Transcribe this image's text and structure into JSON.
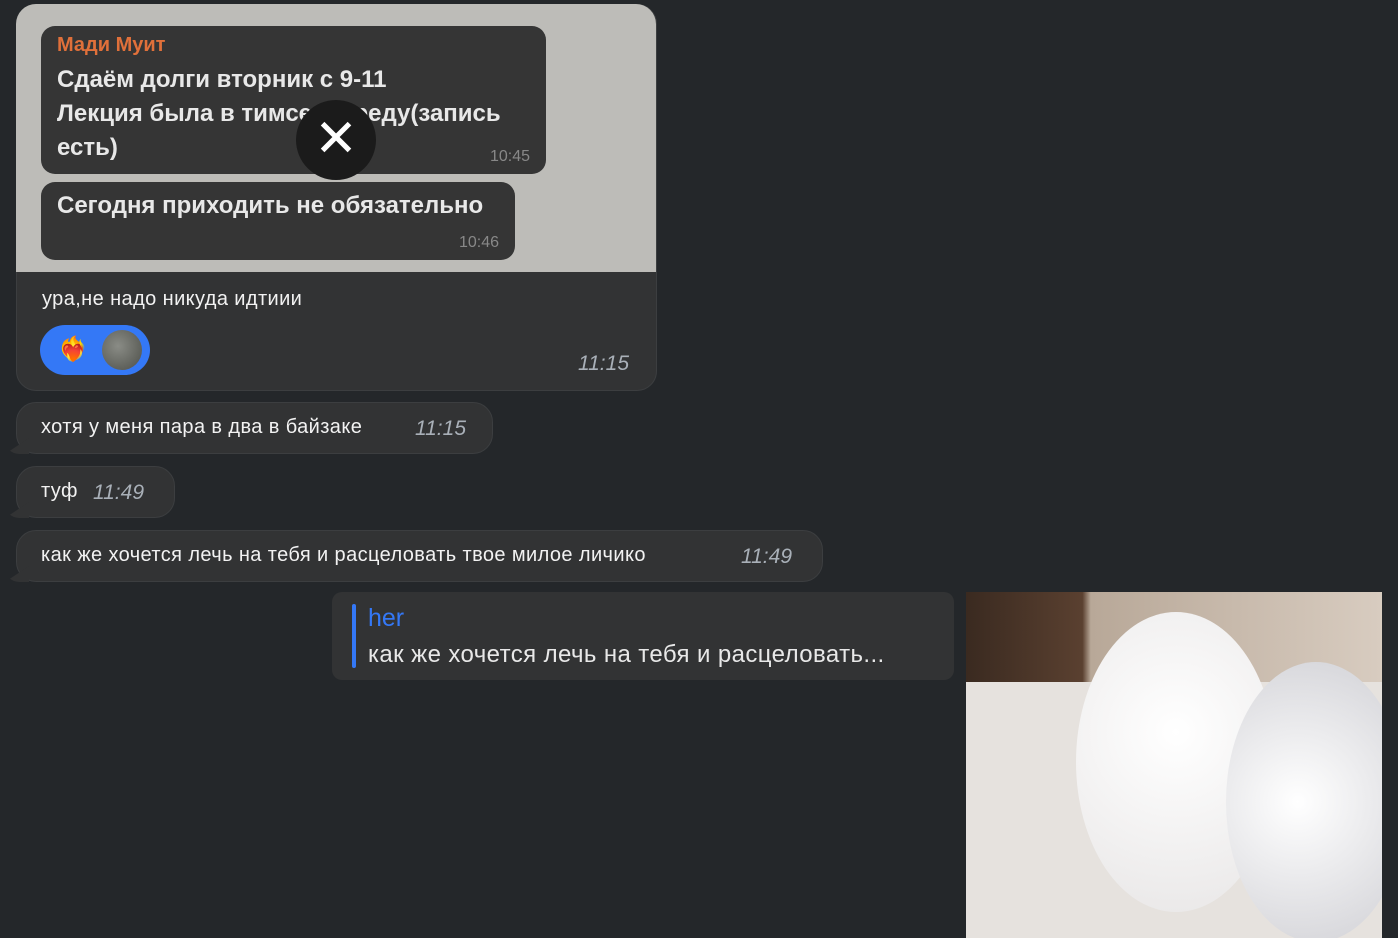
{
  "messages": [
    {
      "forwarded_screenshot": {
        "sender": "Мади Муит",
        "message1": "Сдаём долги вторник с 9-11",
        "message2": "Лекция была в тимсе в среду(запись",
        "message3": "есть)",
        "time1": "10:45",
        "message4": "Сегодня приходить не обязательно",
        "time2": "10:46"
      },
      "text": "ура,не надо никуда идтиии",
      "time": "11:15",
      "reaction": "❤️‍🔥"
    },
    {
      "text": "хотя у меня пара в два в байзаке",
      "time": "11:15"
    },
    {
      "text": "туф",
      "time": "11:49"
    },
    {
      "text": "как же хочется лечь на тебя и расцеловать твое милое личико",
      "time": "11:49"
    }
  ],
  "reply": {
    "author": "her",
    "quote": "как же хочется лечь на тебя и расцеловать..."
  },
  "colors": {
    "accent": "#3478f6",
    "bg": "#24272a",
    "bubble": "#323334",
    "sender": "#e0703a"
  }
}
